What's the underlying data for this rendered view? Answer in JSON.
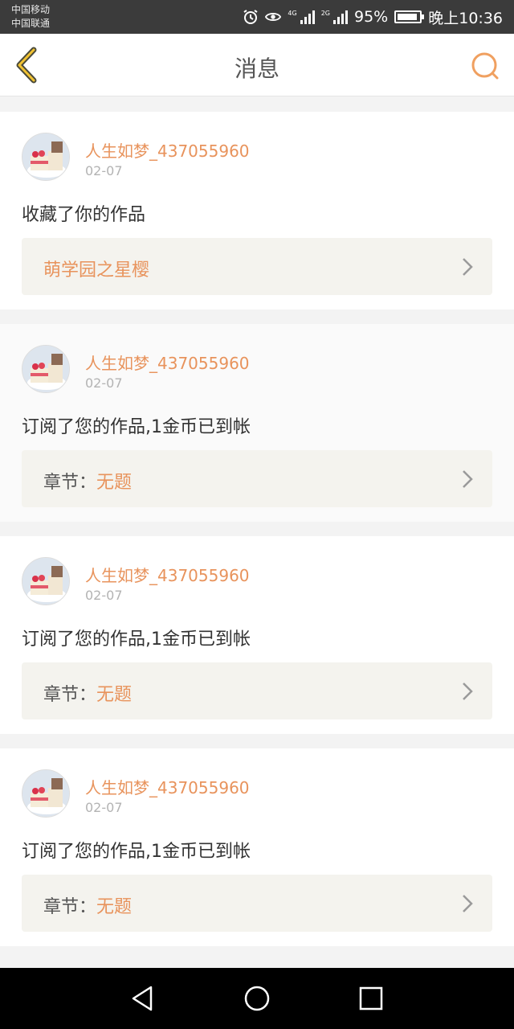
{
  "status_bar": {
    "carrier_1": "中国移动",
    "carrier_2": "中国联通",
    "network_1": "4G",
    "network_2": "2G",
    "battery": "95%",
    "time": "晚上10:36"
  },
  "header": {
    "title": "消息",
    "accent_color": "#f0a060"
  },
  "messages": [
    {
      "username": "人生如梦_437055960",
      "date": "02-07",
      "text": "收藏了你的作品",
      "work_title": "萌学园之星樱"
    },
    {
      "username": "人生如梦_437055960",
      "date": "02-07",
      "text": "订阅了您的作品,1金币已到帐",
      "chapter_label": "章节：",
      "chapter_value": "无题"
    },
    {
      "username": "人生如梦_437055960",
      "date": "02-07",
      "text": "订阅了您的作品,1金币已到帐",
      "chapter_label": "章节：",
      "chapter_value": "无题"
    },
    {
      "username": "人生如梦_437055960",
      "date": "02-07",
      "text": "订阅了您的作品,1金币已到帐",
      "chapter_label": "章节：",
      "chapter_value": "无题"
    }
  ],
  "nav": {
    "back_icon": "triangle-back-icon",
    "home_icon": "circle-home-icon",
    "recents_icon": "square-recents-icon"
  }
}
